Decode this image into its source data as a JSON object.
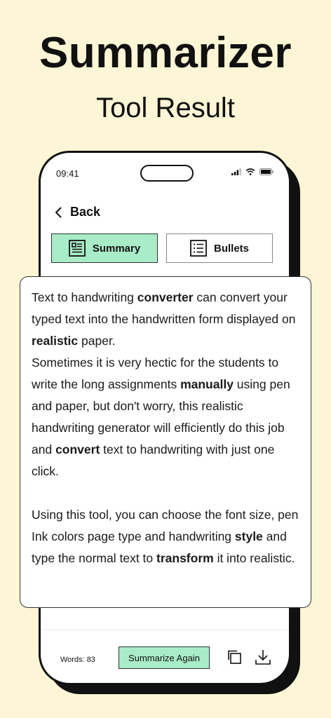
{
  "promo": {
    "headline": "Summarizer",
    "subhead": "Tool Result"
  },
  "status_bar": {
    "time": "09:41",
    "icons": [
      "signal-icon",
      "wifi-icon",
      "battery-icon"
    ]
  },
  "nav": {
    "back_label": "Back"
  },
  "tabs": [
    {
      "label": "Summary",
      "icon": "document-icon",
      "selected": true
    },
    {
      "label": "Bullets",
      "icon": "list-icon",
      "selected": false
    }
  ],
  "result": {
    "p1": [
      {
        "text": "Text to handwriting ",
        "bold": false
      },
      {
        "text": "converter",
        "bold": true
      },
      {
        "text": " can convert your typed text into the handwritten form displayed on ",
        "bold": false
      },
      {
        "text": "realistic",
        "bold": true
      },
      {
        "text": " paper.",
        "bold": false
      }
    ],
    "p2": [
      {
        "text": "Sometimes it is very hectic for the students to write the long assignments ",
        "bold": false
      },
      {
        "text": "manually",
        "bold": true
      },
      {
        "text": " using pen and paper, but don't worry, this realistic handwriting generator will efficiently do this job and ",
        "bold": false
      },
      {
        "text": "convert",
        "bold": true
      },
      {
        "text": " text to handwriting with just one click.",
        "bold": false
      }
    ],
    "p3": [
      {
        "text": "Using this tool, you can choose the font size, pen Ink colors page type and handwriting ",
        "bold": false
      },
      {
        "text": "style",
        "bold": true
      },
      {
        "text": " and type the normal text to ",
        "bold": false
      },
      {
        "text": "transform",
        "bold": true
      },
      {
        "text": " it into realistic.",
        "bold": false
      }
    ]
  },
  "footer": {
    "word_count": "Words: 83",
    "summarize_again_label": "Summarize Again",
    "icons": [
      "copy-icon",
      "download-icon"
    ]
  },
  "colors": {
    "background": "#fdf6d6",
    "accent": "#a8ecc8",
    "ink": "#111111"
  }
}
